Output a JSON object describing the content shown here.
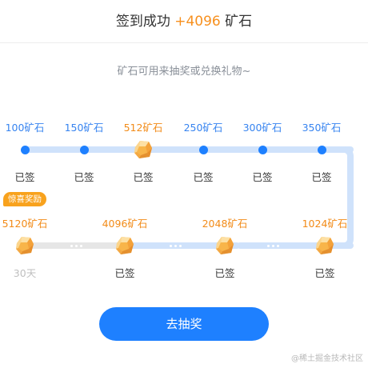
{
  "header": {
    "prefix": "签到成功",
    "amount": "+4096",
    "suffix": "矿石"
  },
  "subtitle": "矿石可用来抽奖或兑换礼物~",
  "colors": {
    "accent": "#1e80ff",
    "orange": "#f7901e",
    "track": "#cfe2fb"
  },
  "row1": [
    {
      "reward": "100矿石",
      "status": "已签",
      "marker": "dot"
    },
    {
      "reward": "150矿石",
      "status": "已签",
      "marker": "dot"
    },
    {
      "reward": "512矿石",
      "status": "已签",
      "marker": "gem"
    },
    {
      "reward": "250矿石",
      "status": "已签",
      "marker": "dot"
    },
    {
      "reward": "300矿石",
      "status": "已签",
      "marker": "dot"
    },
    {
      "reward": "350矿石",
      "status": "已签",
      "marker": "dot"
    }
  ],
  "row2": [
    {
      "reward": "5120矿石",
      "status": "30天",
      "marker": "gem",
      "badge": "惊喜奖励"
    },
    {
      "reward": "4096矿石",
      "status": "已签",
      "marker": "gem"
    },
    {
      "reward": "2048矿石",
      "status": "已签",
      "marker": "gem"
    },
    {
      "reward": "1024矿石",
      "status": "已签",
      "marker": "gem"
    }
  ],
  "cta_label": "去抽奖",
  "watermark": "@稀土掘金技术社区"
}
